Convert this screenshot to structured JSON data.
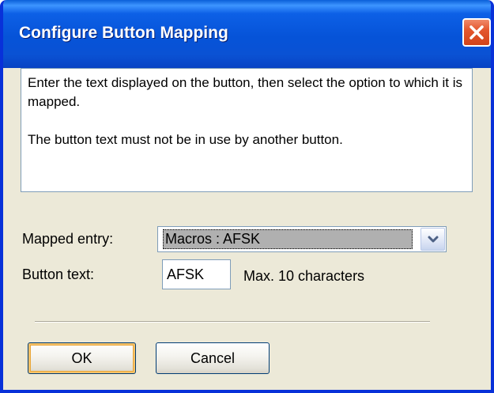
{
  "window": {
    "title": "Configure Button Mapping",
    "colors": {
      "titlebar": "#0653d8",
      "face": "#ece9d8",
      "close_button": "#e4572e",
      "selection_highlight": "#b0b0b0"
    }
  },
  "titlebar": {
    "close_icon": "close-icon"
  },
  "info": {
    "line1": "Enter the text displayed on the button, then select the option to which it is mapped.",
    "line2": "The button text must not be in use by another button."
  },
  "form": {
    "mapped_entry_label": "Mapped entry:",
    "mapped_entry_value": "Macros : AFSK",
    "dropdown_icon": "chevron-down-icon",
    "button_text_label": "Button text:",
    "button_text_value": "AFSK",
    "max_hint": "Max. 10 characters"
  },
  "buttons": {
    "ok_label": "OK",
    "cancel_label": "Cancel"
  }
}
